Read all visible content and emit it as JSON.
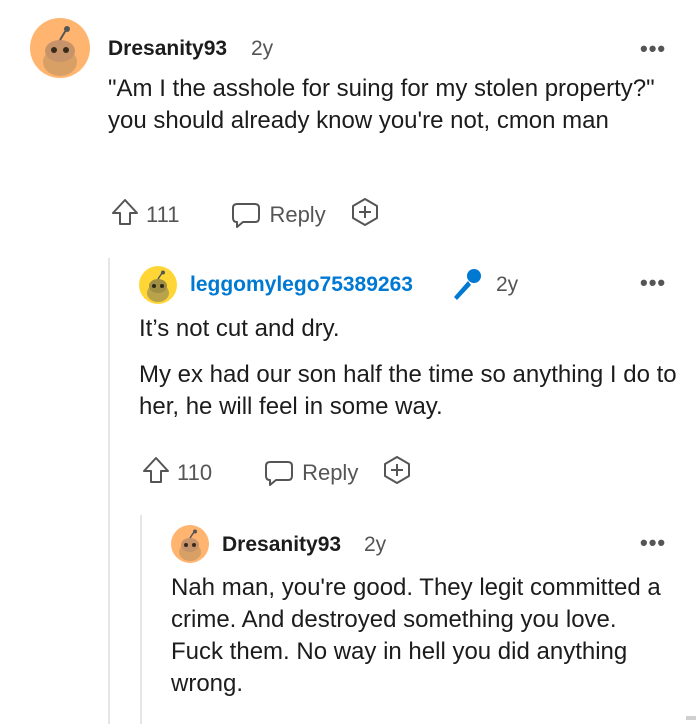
{
  "comments": [
    {
      "username": "Dresanity93",
      "time": "2y",
      "paragraphs": [
        "\"Am I the asshole for suing for my stolen property?\" you should already know you're not, cmon man"
      ],
      "votes": "111",
      "reply_label": "Reply",
      "more": "•••"
    },
    {
      "username": "leggomylego75389263",
      "time": "2y",
      "paragraphs": [
        "It’s not cut and dry.",
        "My ex had our son half the time so anything I do to her, he will feel in some way."
      ],
      "votes": "110",
      "reply_label": "Reply",
      "more": "•••"
    },
    {
      "username": "Dresanity93",
      "time": "2y",
      "paragraphs": [
        "Nah man, you're good. They legit committed a crime. And destroyed something you love. Fuck them. No way in hell you did anything wrong."
      ],
      "more": "•••"
    }
  ],
  "colors": {
    "op_username": "#0079d3",
    "avatar_orange": "#ffb470",
    "avatar_yellow": "#ffd635",
    "mic_icon": "#0079d3"
  }
}
